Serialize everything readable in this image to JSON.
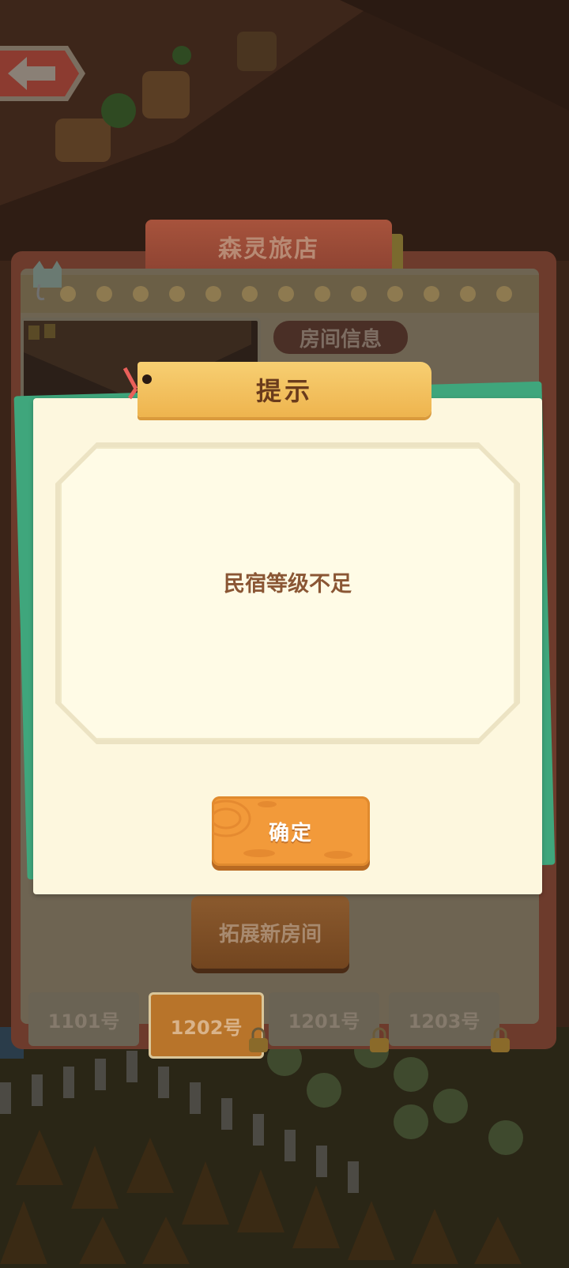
{
  "header": {
    "back_label": "back"
  },
  "panel": {
    "title": "森灵旅店",
    "room_info_label": "房间信息",
    "expand_button": "拓展新房间",
    "tabs": [
      {
        "label": "1101号",
        "active": false,
        "locked": false
      },
      {
        "label": "1202号",
        "active": true,
        "locked": true
      },
      {
        "label": "1201号",
        "active": false,
        "locked": true
      },
      {
        "label": "1203号",
        "active": false,
        "locked": true
      }
    ]
  },
  "dialog": {
    "title": "提示",
    "message": "民宿等级不足",
    "confirm_label": "确定"
  },
  "colors": {
    "dialog_bg": "#fdf7de",
    "title_bar": "#f2c062",
    "confirm_button": "#f29a3a",
    "accent_green": "#3fa67c",
    "message_text": "#8a5634"
  }
}
